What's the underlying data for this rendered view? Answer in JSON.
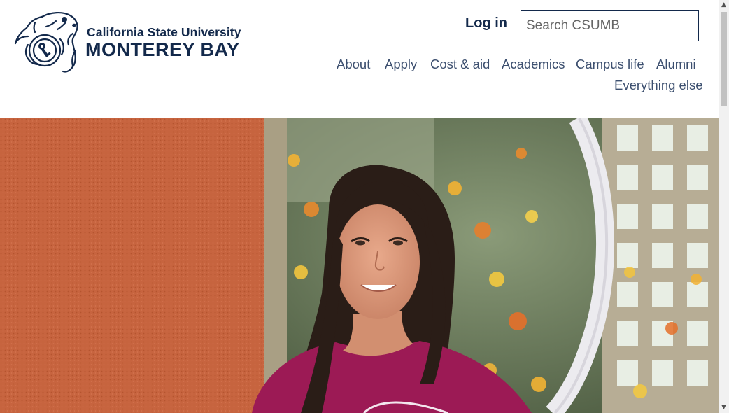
{
  "header": {
    "logo": {
      "line1": "California State University",
      "line2": "MONTEREY BAY",
      "icon": "sea-otter-logo-icon"
    },
    "login_label": "Log in",
    "search": {
      "placeholder": "Search CSUMB",
      "value": ""
    },
    "nav": {
      "items": [
        {
          "label": "About"
        },
        {
          "label": "Apply"
        },
        {
          "label": "Cost & aid"
        },
        {
          "label": "Academics"
        },
        {
          "label": "Campus life"
        },
        {
          "label": "Alumni"
        },
        {
          "label": "Everything else"
        }
      ]
    }
  },
  "hero": {
    "image": "student-portrait-photo"
  },
  "scrollbar": {
    "up_icon": "scroll-up-arrow-icon",
    "down_icon": "scroll-down-arrow-icon"
  },
  "colors": {
    "brand_navy": "#13294b",
    "nav_text": "#3c4f6f",
    "wall_orange": "#c7643f",
    "shirt_magenta": "#9c1a55"
  }
}
